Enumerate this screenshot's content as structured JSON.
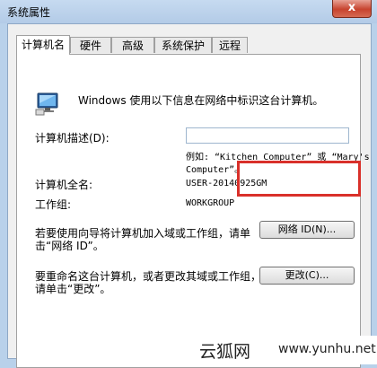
{
  "window": {
    "title": "系统属性",
    "close_glyph": "x"
  },
  "tabs": [
    {
      "label": "计算机名",
      "active": true
    },
    {
      "label": "硬件",
      "active": false
    },
    {
      "label": "高级",
      "active": false
    },
    {
      "label": "系统保护",
      "active": false
    },
    {
      "label": "远程",
      "active": false
    }
  ],
  "panel": {
    "intro": "Windows 使用以下信息在网络中标识这台计算机。",
    "description_label": "计算机描述(D):",
    "description_value": "",
    "example_line1": "例如: “Kitchen Computer” 或 “Mary's",
    "example_line2": "Computer”。",
    "fullname_label": "计算机全名:",
    "fullname_value": "USER-20140925GM",
    "workgroup_label": "工作组:",
    "workgroup_value": "WORKGROUP",
    "network_text_line1": "若要使用向导将计算机加入域或工作组，请单",
    "network_text_line2": "击“网络 ID”。",
    "network_button": "网络 ID(N)...",
    "rename_text_line1": "要重命名这台计算机，或者更改其域或工作组，",
    "rename_text_line2": "请单击“更改”。",
    "change_button": "更改(C)..."
  },
  "watermark": {
    "cn": "云狐网",
    "url": "www.yunhu.net"
  },
  "colors": {
    "highlight": "#d9302a",
    "close_button": "#c7432e",
    "titlebar": "#b9d1ea"
  }
}
